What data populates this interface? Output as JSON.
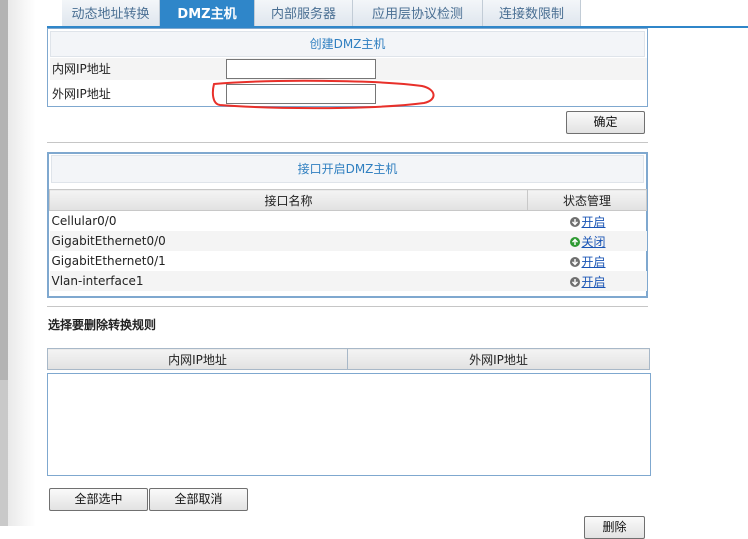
{
  "tabs": [
    {
      "label": "动态地址转换",
      "active": false
    },
    {
      "label": "DMZ主机",
      "active": true
    },
    {
      "label": "内部服务器",
      "active": false
    },
    {
      "label": "应用层协议检测",
      "active": false
    },
    {
      "label": "连接数限制",
      "active": false
    }
  ],
  "create_dmz": {
    "title": "创建DMZ主机",
    "inner_ip_label": "内网IP地址",
    "inner_ip_value": "",
    "outer_ip_label": "外网IP地址",
    "outer_ip_value": "",
    "confirm_label": "确定"
  },
  "interface_dmz": {
    "title": "接口开启DMZ主机",
    "columns": [
      "接口名称",
      "状态管理"
    ],
    "rows": [
      {
        "name": "Cellular0/0",
        "action": "开启",
        "icon": "gray-down-arrow-icon"
      },
      {
        "name": "GigabitEthernet0/0",
        "action": "关闭",
        "icon": "green-up-arrow-icon"
      },
      {
        "name": "GigabitEthernet0/1",
        "action": "开启",
        "icon": "gray-down-arrow-icon"
      },
      {
        "name": "Vlan-interface1",
        "action": "开启",
        "icon": "gray-down-arrow-icon"
      }
    ]
  },
  "delete_rules": {
    "heading": "选择要删除转换规则",
    "columns": [
      "内网IP地址",
      "外网IP地址"
    ],
    "select_all_label": "全部选中",
    "deselect_all_label": "全部取消",
    "delete_label": "删除"
  },
  "colors": {
    "accent": "#2f86c9",
    "annotation": "#e8302a"
  }
}
